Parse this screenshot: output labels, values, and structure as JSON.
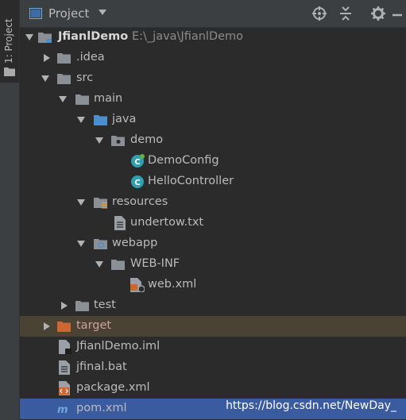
{
  "side_tab": {
    "label": "1: Project"
  },
  "header": {
    "title": "Project"
  },
  "tree": {
    "root": {
      "label": "JfianlDemo",
      "path": "E:\\_java\\JfianlDemo"
    },
    "idea": ".idea",
    "src": "src",
    "main": "main",
    "java": "java",
    "demo": "demo",
    "demo_config": "DemoConfig",
    "hello_controller": "HelloController",
    "resources": "resources",
    "undertow": "undertow.txt",
    "webapp": "webapp",
    "web_inf": "WEB-INF",
    "web_xml": "web.xml",
    "test": "test",
    "target": "target",
    "iml": "JfianlDemo.iml",
    "bat": "jfinal.bat",
    "package_xml": "package.xml",
    "pom_xml": "pom.xml"
  },
  "watermark": "https://blog.csdn.net/NewDay_",
  "colors": {
    "background": "#2b2b2b",
    "panel": "#3c3f41",
    "selected_row": "#3a5ba0",
    "excluded_row": "#4a4232",
    "folder": "#8b9096",
    "source_folder": "#4d8fce",
    "excluded_folder": "#cc6633",
    "java_class": "#2fa0b0"
  }
}
